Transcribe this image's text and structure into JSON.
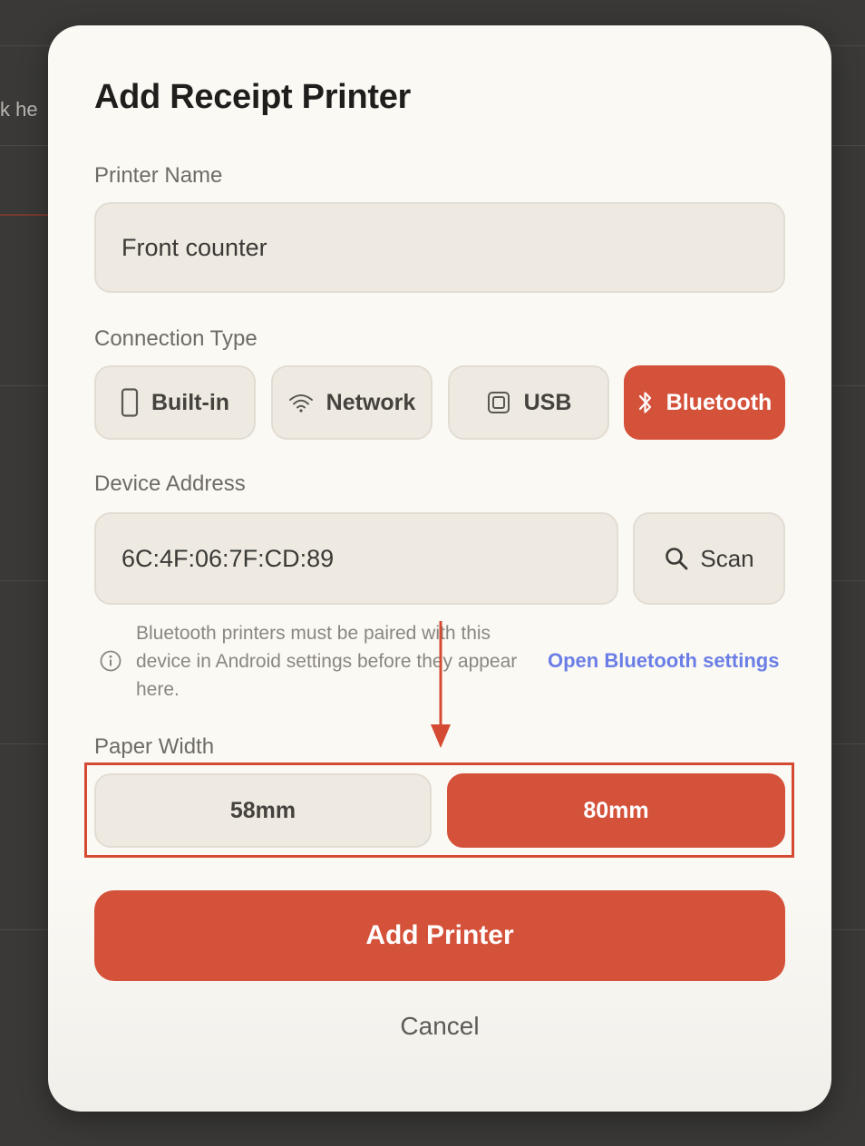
{
  "background": {
    "partial_text": "k he"
  },
  "dialog": {
    "title": "Add Receipt Printer",
    "printer_name": {
      "label": "Printer Name",
      "value": "Front counter"
    },
    "connection_type": {
      "label": "Connection Type",
      "options": [
        {
          "label": "Built-in",
          "icon": "phone-icon"
        },
        {
          "label": "Network",
          "icon": "wifi-icon"
        },
        {
          "label": "USB",
          "icon": "chip-icon"
        },
        {
          "label": "Bluetooth",
          "icon": "bluetooth-icon"
        }
      ],
      "selected": "Bluetooth"
    },
    "device_address": {
      "label": "Device Address",
      "value": "6C:4F:06:7F:CD:89",
      "scan_label": "Scan"
    },
    "info": {
      "text": "Bluetooth printers must be paired with this device in Android settings before they appear here.",
      "link": "Open Bluetooth settings"
    },
    "paper_width": {
      "label": "Paper Width",
      "options": [
        "58mm",
        "80mm"
      ],
      "selected": "80mm"
    },
    "add_button": "Add Printer",
    "cancel_button": "Cancel"
  },
  "colors": {
    "accent": "#d4513a",
    "link": "#6a7ee6",
    "field_bg": "#eeeae2",
    "dialog_bg": "#fbf9f4",
    "annotation": "#d44a33"
  }
}
